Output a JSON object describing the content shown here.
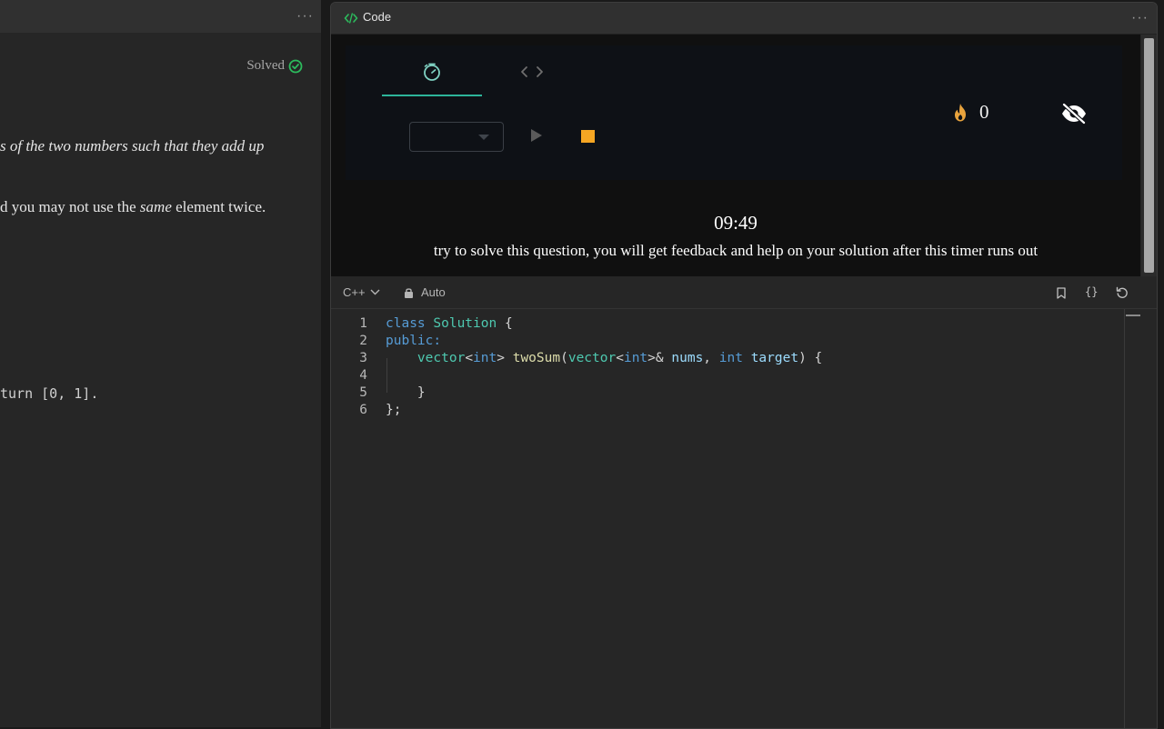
{
  "left_panel": {
    "more_label": "···",
    "solved_label": "Solved",
    "description_lines": [
      "s of the two numbers such that they add up",
      "d you may not use the ",
      "same",
      " element twice."
    ],
    "example_fragment": "turn [0, 1]."
  },
  "code_panel": {
    "title": "Code",
    "more_label": "···",
    "timer_tabs": [
      {
        "icon": "timer-icon",
        "active": true
      },
      {
        "icon": "code-icon",
        "active": false
      }
    ],
    "streak_count": "0",
    "timer_value": "09:49",
    "timer_message": "try to solve this question, you will get feedback and help on your solution after this timer runs out",
    "accent_color": "#e8a33d",
    "tab_underline_color": "#2db59a"
  },
  "editor": {
    "language": "C++",
    "mode": "Auto",
    "lines": [
      {
        "number": "1",
        "tokens": [
          {
            "t": "class ",
            "c": "kw"
          },
          {
            "t": "Solution",
            "c": "ty"
          },
          {
            "t": " {",
            "c": "pl"
          }
        ]
      },
      {
        "number": "2",
        "tokens": [
          {
            "t": "public:",
            "c": "kw"
          }
        ]
      },
      {
        "number": "3",
        "tokens": [
          {
            "t": "    ",
            "c": "pl"
          },
          {
            "t": "vector",
            "c": "ty"
          },
          {
            "t": "<",
            "c": "pl"
          },
          {
            "t": "int",
            "c": "kw"
          },
          {
            "t": "> ",
            "c": "pl"
          },
          {
            "t": "twoSum",
            "c": "fn"
          },
          {
            "t": "(",
            "c": "pl"
          },
          {
            "t": "vector",
            "c": "ty"
          },
          {
            "t": "<",
            "c": "pl"
          },
          {
            "t": "int",
            "c": "kw"
          },
          {
            "t": ">& ",
            "c": "pl"
          },
          {
            "t": "nums",
            "c": "var"
          },
          {
            "t": ", ",
            "c": "pl"
          },
          {
            "t": "int",
            "c": "kw"
          },
          {
            "t": " ",
            "c": "pl"
          },
          {
            "t": "target",
            "c": "var"
          },
          {
            "t": ") {",
            "c": "pl"
          }
        ]
      },
      {
        "number": "4",
        "tokens": []
      },
      {
        "number": "5",
        "tokens": [
          {
            "t": "    }",
            "c": "pl"
          }
        ]
      },
      {
        "number": "6",
        "tokens": [
          {
            "t": "};",
            "c": "pl"
          }
        ]
      }
    ]
  }
}
